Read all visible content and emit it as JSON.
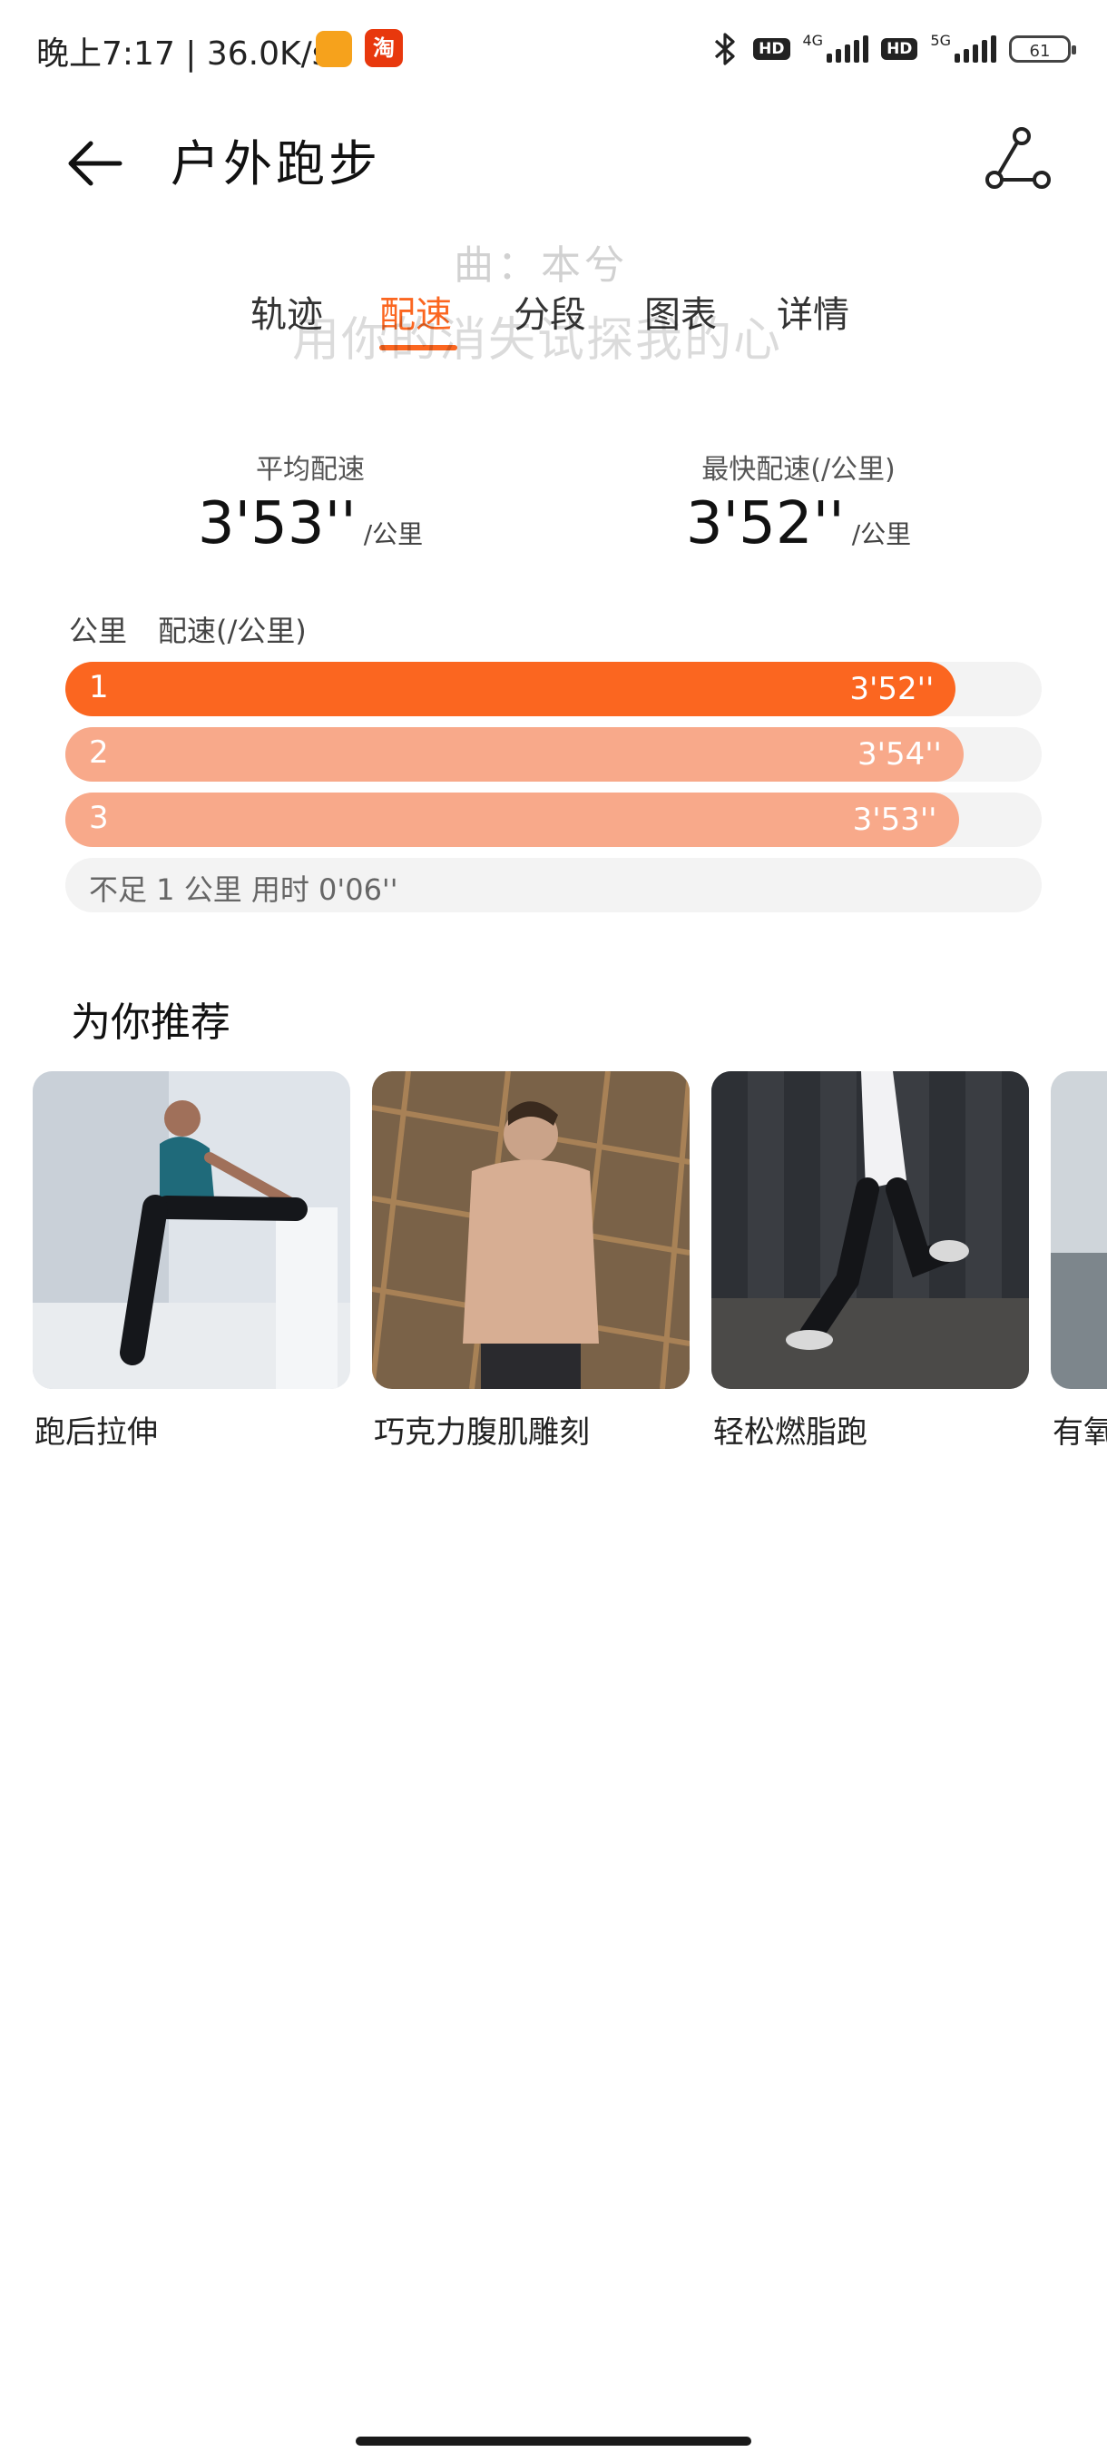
{
  "status_bar": {
    "time_speed": "晚上7:17 | 36.0K/s",
    "taobao_icon_text": "淘",
    "hd_badge": "HD",
    "network_1": "4G",
    "network_2": "5G",
    "battery": "61",
    "icons": [
      "orange-app-icon",
      "taobao-icon",
      "bluetooth-icon",
      "hd-icon",
      "signal-icon",
      "battery-icon"
    ]
  },
  "header": {
    "title": "户外跑步",
    "back_icon": "arrow-left-icon",
    "share_icon": "share-icon"
  },
  "tabs": [
    {
      "label": "轨迹",
      "active": false
    },
    {
      "label": "配速",
      "active": true
    },
    {
      "label": "分段",
      "active": false
    },
    {
      "label": "图表",
      "active": false
    },
    {
      "label": "详情",
      "active": false
    }
  ],
  "watermark": {
    "line1": "曲：本兮",
    "line2": "用你的消失试探我的心"
  },
  "stats": {
    "avg": {
      "label": "平均配速",
      "value": "3'53''",
      "unit": "/公里"
    },
    "fastest": {
      "label": "最快配速(/公里)",
      "value": "3'52''",
      "unit": "/公里"
    }
  },
  "splits": {
    "col_km": "公里",
    "col_pace": "配速(/公里)",
    "rows": [
      {
        "index": "1",
        "pace": "3'52''",
        "fraction": 0.912,
        "color": "#fb6620"
      },
      {
        "index": "2",
        "pace": "3'54''",
        "fraction": 0.92,
        "color": "#f8a98a"
      },
      {
        "index": "3",
        "pace": "3'53''",
        "fraction": 0.915,
        "color": "#f8a98a"
      }
    ],
    "remainder": "不足 1 公里 用时 0'06''"
  },
  "recommend": {
    "title": "为你推荐",
    "items": [
      {
        "label": "跑后拉伸"
      },
      {
        "label": "巧克力腹肌雕刻"
      },
      {
        "label": "轻松燃脂跑"
      },
      {
        "label": "有氧"
      }
    ]
  },
  "colors": {
    "accent": "#fb6620",
    "accent_light": "#f8a98a",
    "track": "#f3f3f3"
  }
}
